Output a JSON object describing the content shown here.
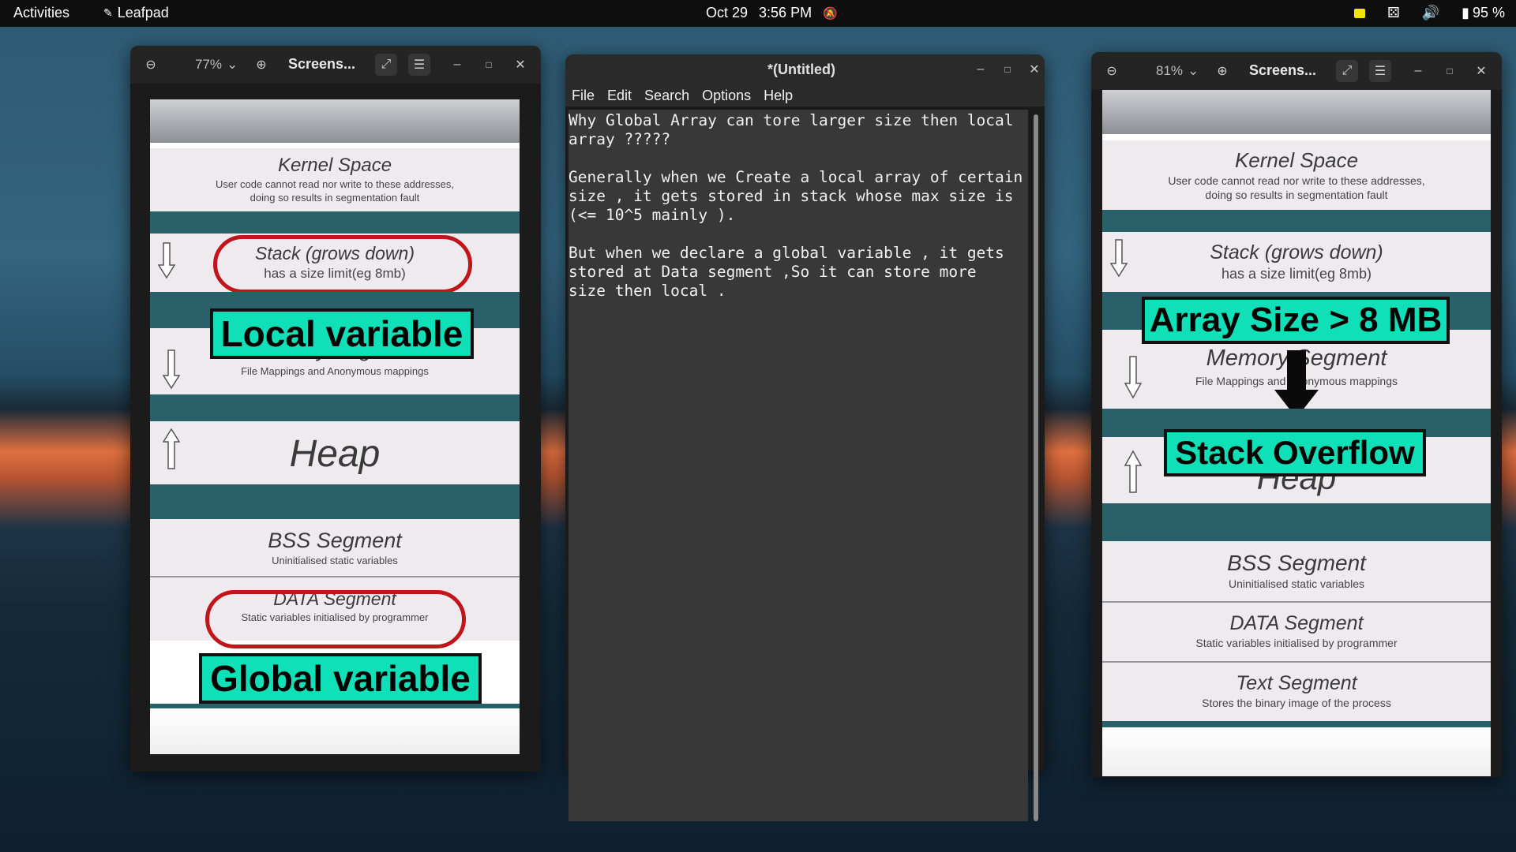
{
  "topbar": {
    "activities": "Activities",
    "app_name": "Leafpad",
    "date": "Oct 29",
    "time": "3:56 PM",
    "battery": "95 %"
  },
  "left_viewer": {
    "zoom": "77%",
    "title": "Screens...",
    "diagram": {
      "kernel_title": "Kernel Space",
      "kernel_desc_1": "User code cannot read nor write to these addresses,",
      "kernel_desc_2": "doing so results in segmentation fault",
      "stack_title": "Stack (grows down)",
      "stack_desc": "has a size limit(eg 8mb)",
      "memory_title": "Memory Segment",
      "memory_desc": "File Mappings and Anonymous mappings",
      "heap_title": "Heap",
      "bss_title": "BSS Segment",
      "bss_desc": "Uninitialised static variables",
      "data_title": "DATA Segment",
      "data_desc": "Static variables initialised by programmer",
      "label_local": "Local variable",
      "label_global": "Global variable"
    }
  },
  "leafpad": {
    "title": "*(Untitled)",
    "menu": [
      "File",
      "Edit",
      "Search",
      "Options",
      "Help"
    ],
    "text": "Why Global Array can tore larger size then local\narray ?????\n\nGenerally when we Create a local array of certain\nsize , it gets stored in stack whose max size is\n(<= 10^5 mainly ).\n\nBut when we declare a global variable , it gets\nstored at Data segment ,So it can store more\nsize then local ."
  },
  "right_viewer": {
    "zoom": "81%",
    "title": "Screens...",
    "diagram": {
      "kernel_title": "Kernel Space",
      "kernel_desc_1": "User code cannot read nor write to these addresses,",
      "kernel_desc_2": "doing so results in segmentation fault",
      "stack_title": "Stack (grows down)",
      "stack_desc": "has a size limit(eg 8mb)",
      "memory_title": "Memory Segment",
      "memory_desc": "File Mappings and Anonymous mappings",
      "heap_title": "Heap",
      "bss_title": "BSS Segment",
      "bss_desc": "Uninitialised static variables",
      "data_title": "DATA Segment",
      "data_desc": "Static variables initialised by programmer",
      "text_title": "Text Segment",
      "text_desc": "Stores the binary image of the process",
      "label_array": "Array Size > 8 MB",
      "label_overflow": "Stack Overflow"
    }
  },
  "icons": [
    "zoom-out-icon",
    "zoom-in-icon",
    "fullscreen-icon",
    "menu-icon",
    "minimize-icon",
    "maximize-icon",
    "close-icon",
    "arrow-down-icon",
    "arrow-up-icon",
    "notifications-off-icon",
    "accessibility-icon",
    "volume-icon",
    "battery-icon",
    "leafpad-app-icon"
  ],
  "colors": {
    "teal_band": "#2a6069",
    "cyan_label": "#10e0b8",
    "red_oval": "#c0151b",
    "topbar": "#0e0e0e"
  }
}
